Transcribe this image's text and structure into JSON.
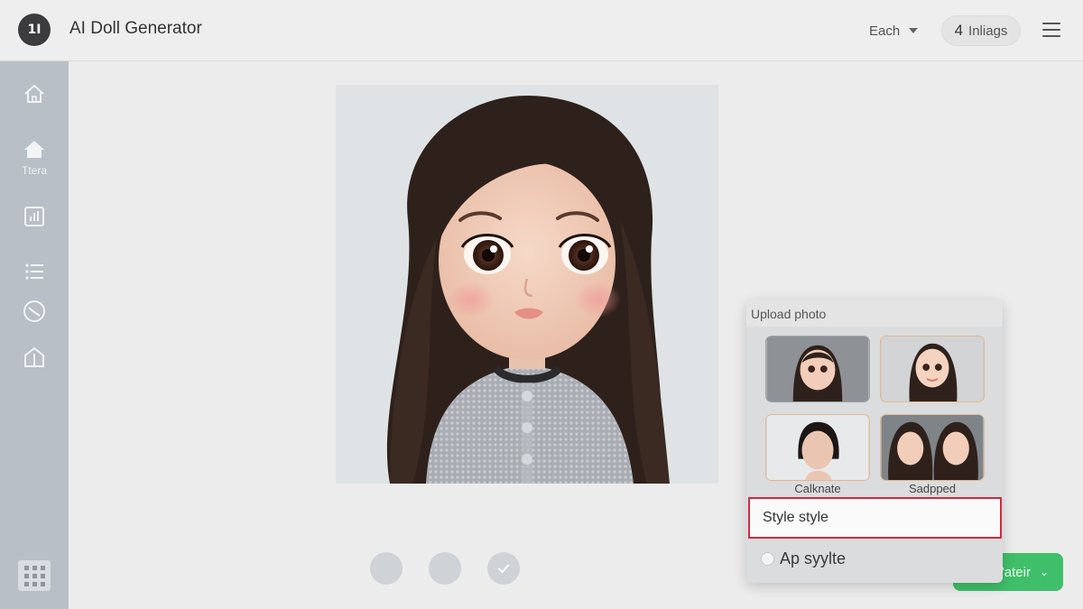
{
  "app": {
    "logo_text": "1I",
    "title": "AI Doll Generator"
  },
  "header": {
    "select_value": "Each",
    "images_count": "4",
    "images_label": "Inliags"
  },
  "sidebar": {
    "items": [
      {
        "icon": "home-outline-icon",
        "label": ""
      },
      {
        "icon": "home-filled-icon",
        "label": "Ttera"
      },
      {
        "icon": "chart-icon",
        "label": ""
      },
      {
        "icon": "list-icon",
        "label": ""
      },
      {
        "icon": "history-icon",
        "label": ""
      },
      {
        "icon": "building-icon",
        "label": ""
      }
    ],
    "apps_icon": "grid-icon"
  },
  "preview": {
    "subject": "doll portrait"
  },
  "actions": {
    "dots": [
      "option-1",
      "option-2",
      "confirm"
    ]
  },
  "generate_button": {
    "label": "'ateir"
  },
  "panel": {
    "heading": "Upload photo",
    "thumbnails": [
      {
        "caption": ""
      },
      {
        "caption": ""
      },
      {
        "caption": "Calknate"
      },
      {
        "caption": "Sadpped"
      }
    ],
    "style_input_value": "Style style",
    "radio_label": "Ap syylte"
  },
  "colors": {
    "accent_green": "#3fbf6a",
    "highlight_red": "#cf2a3f",
    "sidebar_bg": "#b9bfc6"
  }
}
